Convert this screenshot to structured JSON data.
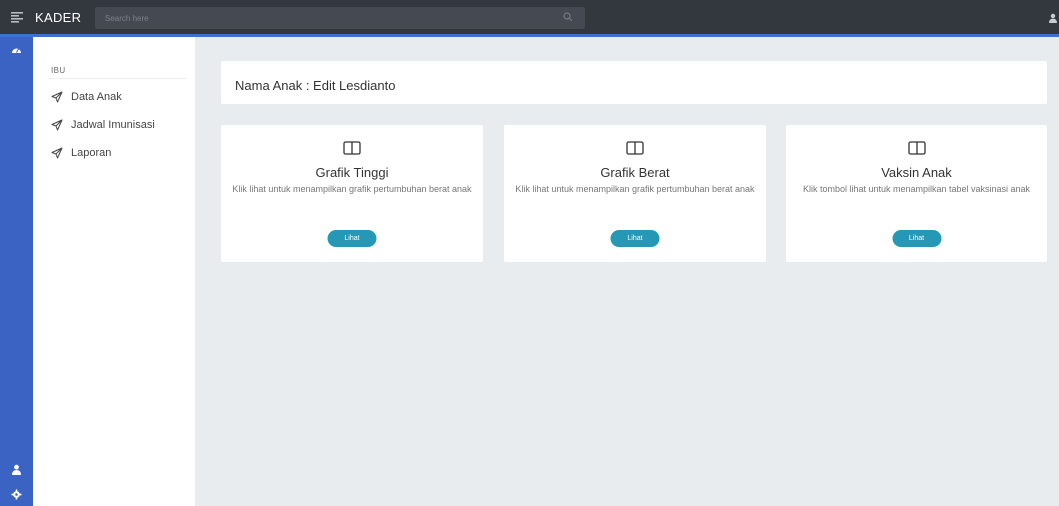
{
  "header": {
    "brand": "KADER",
    "search_placeholder": "Search here"
  },
  "sidebar": {
    "section": "IBU",
    "items": [
      {
        "label": "Data Anak"
      },
      {
        "label": "Jadwal Imunisasi"
      },
      {
        "label": "Laporan"
      }
    ]
  },
  "main": {
    "title": "Nama Anak : Edit Lesdianto",
    "cards": [
      {
        "title": "Grafik Tinggi",
        "desc": "Klik lihat untuk menampilkan grafik pertumbuhan berat anak",
        "button": "Lihat"
      },
      {
        "title": "Grafik Berat",
        "desc": "Klik lihat untuk menampilkan grafik pertumbuhan berat anak",
        "button": "Lihat"
      },
      {
        "title": "Vaksin Anak",
        "desc": "Klik tombol lihat untuk menampilkan tabel vaksinasi anak",
        "button": "Lihat"
      }
    ]
  },
  "colors": {
    "topbar": "#33373e",
    "rail": "#3b63c4",
    "accent_line": "#3f6fcf",
    "button": "#2598b5",
    "background": "#e9ecef"
  }
}
